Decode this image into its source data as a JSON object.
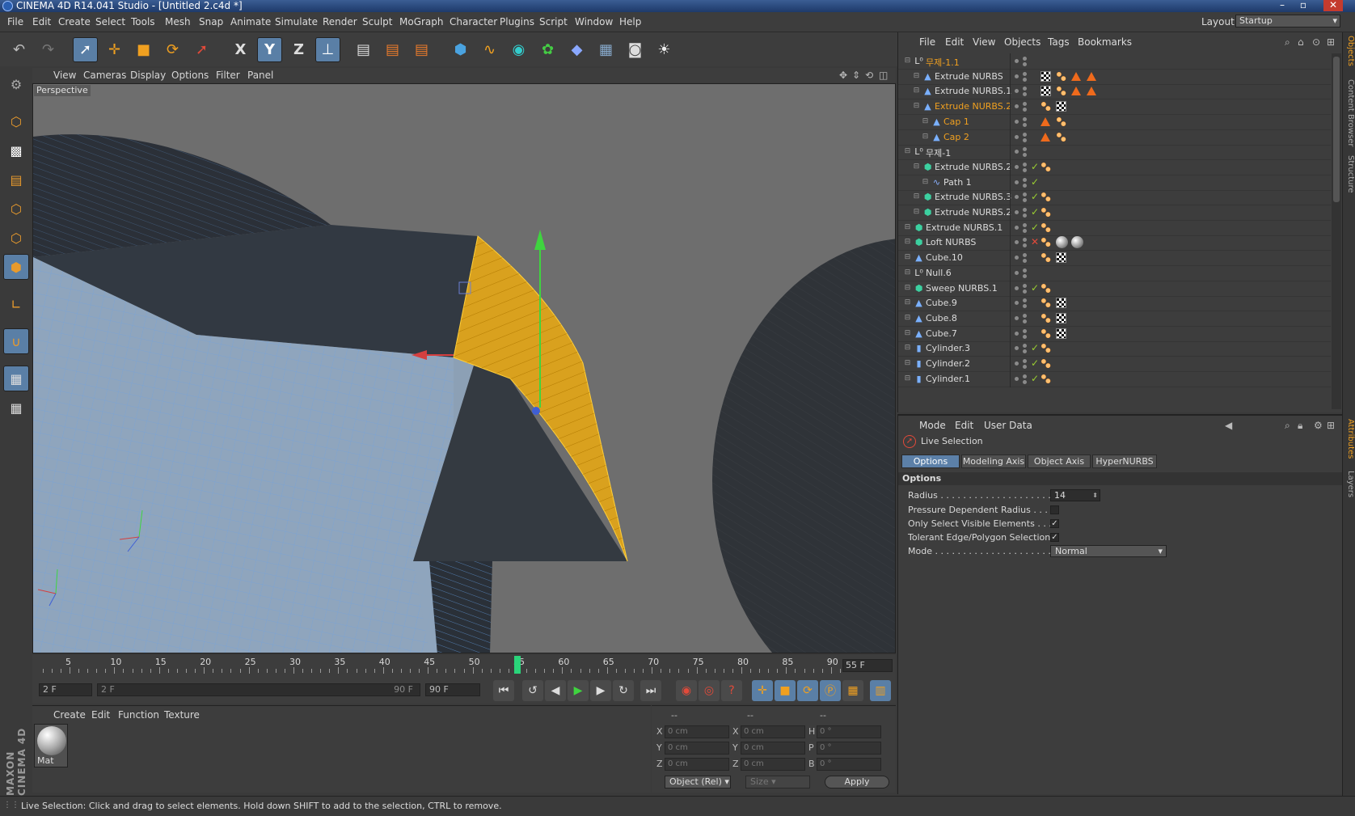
{
  "window": {
    "title": "CINEMA 4D R14.041 Studio - [Untitled 2.c4d *]"
  },
  "menu": [
    "File",
    "Edit",
    "Create",
    "Select",
    "Tools",
    "Mesh",
    "Snap",
    "Animate",
    "Simulate",
    "Render",
    "Sculpt",
    "MoGraph",
    "Character",
    "Plugins",
    "Script",
    "Window",
    "Help"
  ],
  "layout": {
    "label": "Layout:",
    "value": "Startup"
  },
  "toolbar": {
    "x_axis": "X",
    "y_axis": "Y",
    "z_axis": "Z"
  },
  "viewport": {
    "menu": [
      "View",
      "Cameras",
      "Display",
      "Options",
      "Filter",
      "Panel"
    ],
    "label": "Perspective"
  },
  "timeline": {
    "ticks": [
      "5",
      "10",
      "15",
      "20",
      "25",
      "30",
      "35",
      "40",
      "45",
      "50",
      "55",
      "60",
      "65",
      "70",
      "75",
      "80",
      "85",
      "90"
    ],
    "current_frame": "55 F",
    "current_frame_value": 55
  },
  "transport": {
    "start": "2 F",
    "range_start": "2 F",
    "range_end": "90 F",
    "end": "90 F"
  },
  "material": {
    "menu": [
      "Create",
      "Edit",
      "Function",
      "Texture"
    ],
    "items": [
      {
        "name": "Mat"
      }
    ]
  },
  "coords": {
    "headers": [
      "--",
      "--",
      "--"
    ],
    "rows": [
      {
        "a": "X",
        "av": "0 cm",
        "b": "X",
        "bv": "0 cm",
        "c": "H",
        "cv": "0 °"
      },
      {
        "a": "Y",
        "av": "0 cm",
        "b": "Y",
        "bv": "0 cm",
        "c": "P",
        "cv": "0 °"
      },
      {
        "a": "Z",
        "av": "0 cm",
        "b": "Z",
        "bv": "0 cm",
        "c": "B",
        "cv": "0 °"
      }
    ],
    "mode": "Object (Rel)",
    "size": "Size",
    "apply": "Apply"
  },
  "objects": {
    "menu": [
      "File",
      "Edit",
      "View",
      "Objects",
      "Tags",
      "Bookmarks"
    ],
    "rows": [
      {
        "name": "무제-1.1",
        "indent": 0,
        "icon": "null",
        "selected": true,
        "status": "",
        "tags": []
      },
      {
        "name": "Extrude NURBS",
        "indent": 1,
        "icon": "poly",
        "selected": false,
        "status": "",
        "tags": [
          "uvw",
          "phong",
          "sel",
          "sel"
        ]
      },
      {
        "name": "Extrude NURBS.1",
        "indent": 1,
        "icon": "poly",
        "selected": false,
        "status": "",
        "tags": [
          "uvw",
          "phong",
          "sel",
          "sel"
        ]
      },
      {
        "name": "Extrude NURBS.2",
        "indent": 1,
        "icon": "poly",
        "selected": true,
        "status": "",
        "tags": [
          "phong",
          "uvw"
        ]
      },
      {
        "name": "Cap 1",
        "indent": 2,
        "icon": "poly",
        "selected": true,
        "status": "",
        "tags": [
          "sel",
          "phong"
        ]
      },
      {
        "name": "Cap 2",
        "indent": 2,
        "icon": "poly",
        "selected": true,
        "status": "",
        "tags": [
          "sel",
          "phong"
        ]
      },
      {
        "name": "무제-1",
        "indent": 0,
        "icon": "null",
        "selected": false,
        "status": "",
        "tags": []
      },
      {
        "name": "Extrude NURBS.2",
        "indent": 1,
        "icon": "gen",
        "selected": false,
        "status": "✓",
        "tags": [
          "phong"
        ]
      },
      {
        "name": "Path 1",
        "indent": 2,
        "icon": "spline",
        "selected": false,
        "status": "✓",
        "tags": []
      },
      {
        "name": "Extrude NURBS.3",
        "indent": 1,
        "icon": "gen",
        "selected": false,
        "status": "✓",
        "tags": [
          "phong"
        ]
      },
      {
        "name": "Extrude NURBS.2",
        "indent": 1,
        "icon": "gen",
        "selected": false,
        "status": "✓",
        "tags": [
          "phong"
        ]
      },
      {
        "name": "Extrude NURBS.1",
        "indent": 0,
        "icon": "gen",
        "selected": false,
        "status": "✓",
        "tags": [
          "phong"
        ]
      },
      {
        "name": "Loft NURBS",
        "indent": 0,
        "icon": "gen",
        "selected": false,
        "status": "✕",
        "tags": [
          "phong",
          "mat",
          "mat"
        ]
      },
      {
        "name": "Cube.10",
        "indent": 0,
        "icon": "poly",
        "selected": false,
        "status": "",
        "tags": [
          "phong",
          "uvw"
        ]
      },
      {
        "name": "Null.6",
        "indent": 0,
        "icon": "null",
        "selected": false,
        "status": "",
        "tags": []
      },
      {
        "name": "Sweep NURBS.1",
        "indent": 0,
        "icon": "gen",
        "selected": false,
        "status": "✓",
        "tags": [
          "phong"
        ]
      },
      {
        "name": "Cube.9",
        "indent": 0,
        "icon": "poly",
        "selected": false,
        "status": "",
        "tags": [
          "phong",
          "uvw"
        ]
      },
      {
        "name": "Cube.8",
        "indent": 0,
        "icon": "poly",
        "selected": false,
        "status": "",
        "tags": [
          "phong",
          "uvw"
        ]
      },
      {
        "name": "Cube.7",
        "indent": 0,
        "icon": "poly",
        "selected": false,
        "status": "",
        "tags": [
          "phong",
          "uvw"
        ]
      },
      {
        "name": "Cylinder.3",
        "indent": 0,
        "icon": "cyl",
        "selected": false,
        "status": "✓",
        "tags": [
          "phong"
        ]
      },
      {
        "name": "Cylinder.2",
        "indent": 0,
        "icon": "cyl",
        "selected": false,
        "status": "✓",
        "tags": [
          "phong"
        ]
      },
      {
        "name": "Cylinder.1",
        "indent": 0,
        "icon": "cyl",
        "selected": false,
        "status": "✓",
        "tags": [
          "phong"
        ]
      }
    ]
  },
  "attributes": {
    "menu": [
      "Mode",
      "Edit",
      "User Data"
    ],
    "tool": "Live Selection",
    "tabs": [
      "Options",
      "Modeling Axis",
      "Object Axis",
      "HyperNURBS"
    ],
    "section": "Options",
    "props": [
      {
        "label": "Radius . . . . . . . . . . . . . . . . . . . . . . .",
        "type": "number",
        "value": "14"
      },
      {
        "label": "Pressure Dependent Radius . . . . .",
        "type": "check",
        "value": ""
      },
      {
        "label": "Only Select Visible Elements . . . .",
        "type": "check",
        "value": "✓"
      },
      {
        "label": "Tolerant Edge/Polygon Selection",
        "type": "check",
        "value": "✓"
      },
      {
        "label": "Mode . . . . . . . . . . . . . . . . . . . . . . . . .",
        "type": "select",
        "value": "Normal"
      }
    ]
  },
  "right_tabs": [
    "Objects",
    "Content Browser",
    "Structure",
    "Attributes",
    "Layers"
  ],
  "brand": "MAXON CINEMA 4D",
  "status": "Live Selection: Click and drag to select elements. Hold down SHIFT to add to the selection, CTRL to remove.",
  "colors": {
    "accent": "#5a7fa6",
    "selection": "#f0a020",
    "viewport_bg": "#6e6e6e"
  }
}
